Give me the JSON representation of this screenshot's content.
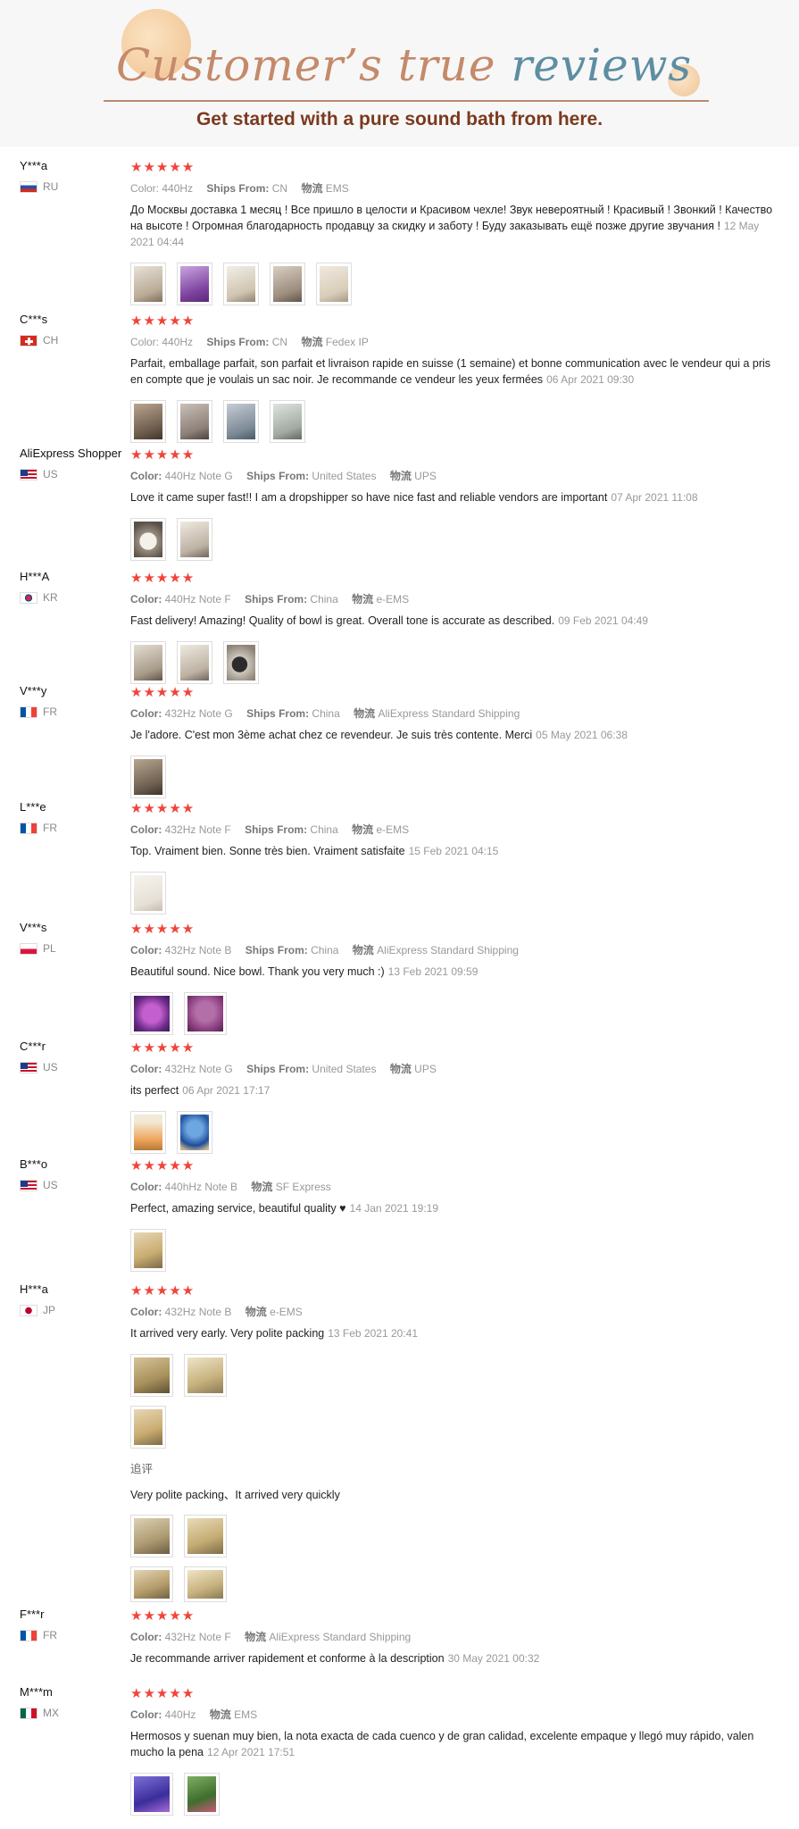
{
  "header": {
    "title_part1": "Customer’s",
    "title_part2": "true",
    "title_part3": "reviews",
    "subtitle": "Get started with a pure sound bath from here."
  },
  "colors": {
    "star": "#f0443a",
    "subtitle": "#7a3a1e",
    "title_warm": "#c48a6a",
    "title_cool": "#5d8ea2"
  },
  "reviews": [
    {
      "user": "Y***a",
      "country": "RU",
      "stars": "★★★★★",
      "meta": [
        [
          "Color:",
          "440Hz"
        ],
        [
          "Ships From:",
          "CN"
        ],
        [
          "物流",
          "EMS"
        ]
      ],
      "text": "До Москвы доставка 1 месяц ! Все пришло в целости и Красивом чехле! Звук невероятный ! Красивый ! Звонкий ! Качество на высоте ! Огромная благодарность продавцу за скидку и заботу ! Буду заказывать ещё позже другие звучания !",
      "date": "12 May 2021 04:44",
      "images": [
        "bowl-photo",
        "bowl-photo",
        "bowl-photo",
        "bowl-photo",
        "bowl-photo"
      ]
    },
    {
      "user": "C***s",
      "country": "CH",
      "stars": "★★★★★",
      "meta": [
        [
          "Color:",
          "440Hz"
        ],
        [
          "Ships From:",
          "CN"
        ],
        [
          "物流",
          "Fedex IP"
        ]
      ],
      "text": "Parfait, emballage parfait, son parfait et livraison rapide en suisse (1 semaine) et bonne communication avec le vendeur qui a pris en compte que je voulais un sac noir. Je recommande ce vendeur les yeux fermées",
      "date": "06 Apr 2021 09:30",
      "images": [
        "bowl-photo",
        "bowl-photo",
        "bowl-photo",
        "bowl-photo"
      ]
    },
    {
      "user": "AliExpress Shopper",
      "country": "US",
      "stars": "★★★★★",
      "meta": [
        [
          "Color:",
          "440Hz Note G"
        ],
        [
          "Ships From:",
          "United States"
        ],
        [
          "物流",
          "UPS"
        ]
      ],
      "text": "Love it came super fast!! I am a dropshipper so have nice fast and reliable vendors are important",
      "date": "07 Apr 2021 11:08",
      "images": [
        "bowl-photo",
        "bowl-photo"
      ]
    },
    {
      "user": "H***A",
      "country": "KR",
      "stars": "★★★★★",
      "meta": [
        [
          "Color:",
          "440Hz Note F"
        ],
        [
          "Ships From:",
          "China"
        ],
        [
          "物流",
          "e-EMS"
        ]
      ],
      "text": "Fast delivery! Amazing! Quality of bowl is great. Overall tone is accurate as described.",
      "date": "09 Feb 2021 04:49",
      "images": [
        "bowl-photo",
        "bowl-photo",
        "bowl-photo"
      ]
    },
    {
      "user": "V***y",
      "country": "FR",
      "stars": "★★★★★",
      "meta": [
        [
          "Color:",
          "432Hz Note G"
        ],
        [
          "Ships From:",
          "China"
        ],
        [
          "物流",
          "AliExpress Standard Shipping"
        ]
      ],
      "text": "Je l'adore. C'est mon 3ème achat chez ce revendeur. Je suis très contente. Merci",
      "date": "05 May 2021 06:38",
      "images": [
        "bowl-photo"
      ]
    },
    {
      "user": "L***e",
      "country": "FR",
      "stars": "★★★★★",
      "meta": [
        [
          "Color:",
          "432Hz Note F"
        ],
        [
          "Ships From:",
          "China"
        ],
        [
          "物流",
          "e-EMS"
        ]
      ],
      "text": "Top. Vraiment bien. Sonne très bien. Vraiment satisfaite",
      "date": "15 Feb 2021 04:15",
      "images": [
        "bowl-photo"
      ]
    },
    {
      "user": "V***s",
      "country": "PL",
      "stars": "★★★★★",
      "meta": [
        [
          "Color:",
          "432Hz Note B"
        ],
        [
          "Ships From:",
          "China"
        ],
        [
          "物流",
          "AliExpress Standard Shipping"
        ]
      ],
      "text": "Beautiful sound. Nice bowl. Thank you very much :)",
      "date": "13 Feb 2021 09:59",
      "images": [
        "bowl-photo",
        "bowl-photo"
      ]
    },
    {
      "user": "C***r",
      "country": "US",
      "stars": "★★★★★",
      "meta": [
        [
          "Color:",
          "432Hz Note G"
        ],
        [
          "Ships From:",
          "United States"
        ],
        [
          "物流",
          "UPS"
        ]
      ],
      "text": "its perfect",
      "date": "06 Apr 2021 17:17",
      "images": [
        "bowl-photo",
        "bowl-photo"
      ]
    },
    {
      "user": "B***o",
      "country": "US",
      "stars": "★★★★★",
      "meta": [
        [
          "Color:",
          "440hHz Note B"
        ],
        [
          "物流",
          "SF Express"
        ]
      ],
      "text": "Perfect, amazing service, beautiful quality ♥",
      "date": "14 Jan 2021 19:19",
      "images": [
        "bowl-photo"
      ]
    },
    {
      "user": "H***a",
      "country": "JP",
      "stars": "★★★★★",
      "meta": [
        [
          "Color:",
          "432Hz Note B"
        ],
        [
          "物流",
          "e-EMS"
        ]
      ],
      "text": "It arrived very early. Very polite packing",
      "date": "13 Feb 2021 20:41",
      "images": [
        "bowl-photo",
        "bowl-photo"
      ],
      "followup_label": "追评",
      "followup_text": "Very polite packing、It arrived very quickly"
    },
    {
      "user": "F***r",
      "country": "FR",
      "stars": "★★★★★",
      "meta": [
        [
          "Color:",
          "432Hz Note F"
        ],
        [
          "物流",
          "AliExpress Standard Shipping"
        ]
      ],
      "text": "Je recommande arriver rapidement et conforme à la description",
      "date": "30 May 2021 00:32",
      "images": []
    },
    {
      "user": "M***m",
      "country": "MX",
      "stars": "★★★★★",
      "meta": [
        [
          "Color:",
          "440Hz"
        ],
        [
          "物流",
          "EMS"
        ]
      ],
      "text": "Hermosos y suenan muy bien, la nota exacta de cada cuenco y de gran calidad, excelente empaque y llegó muy rápido, valen mucho la pena",
      "date": "12 Apr 2021 17:51",
      "images": [
        "bowl-photo",
        "bowl-photo"
      ]
    }
  ]
}
